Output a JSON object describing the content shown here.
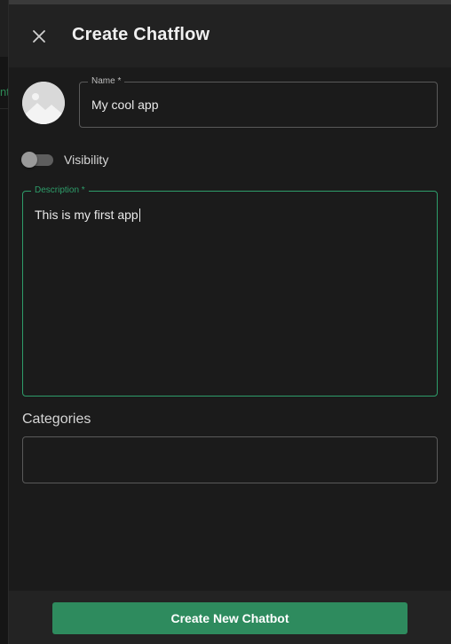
{
  "background": {
    "peek_text": "nt"
  },
  "dialog": {
    "title": "Create Chatflow",
    "close_icon": "close-icon"
  },
  "avatar": {
    "icon": "image-placeholder-icon"
  },
  "name_field": {
    "label": "Name *",
    "value": "My cool app"
  },
  "visibility": {
    "label": "Visibility",
    "enabled": false
  },
  "description_field": {
    "label": "Description *",
    "value": "This is my first app",
    "focused": true
  },
  "categories": {
    "label": "Categories",
    "value": ""
  },
  "footer": {
    "submit_label": "Create New Chatbot"
  },
  "colors": {
    "accent": "#2e8b5e",
    "focus_border": "#2e9d6a",
    "panel_bg": "#1b1b1b",
    "header_bg": "#222222"
  }
}
